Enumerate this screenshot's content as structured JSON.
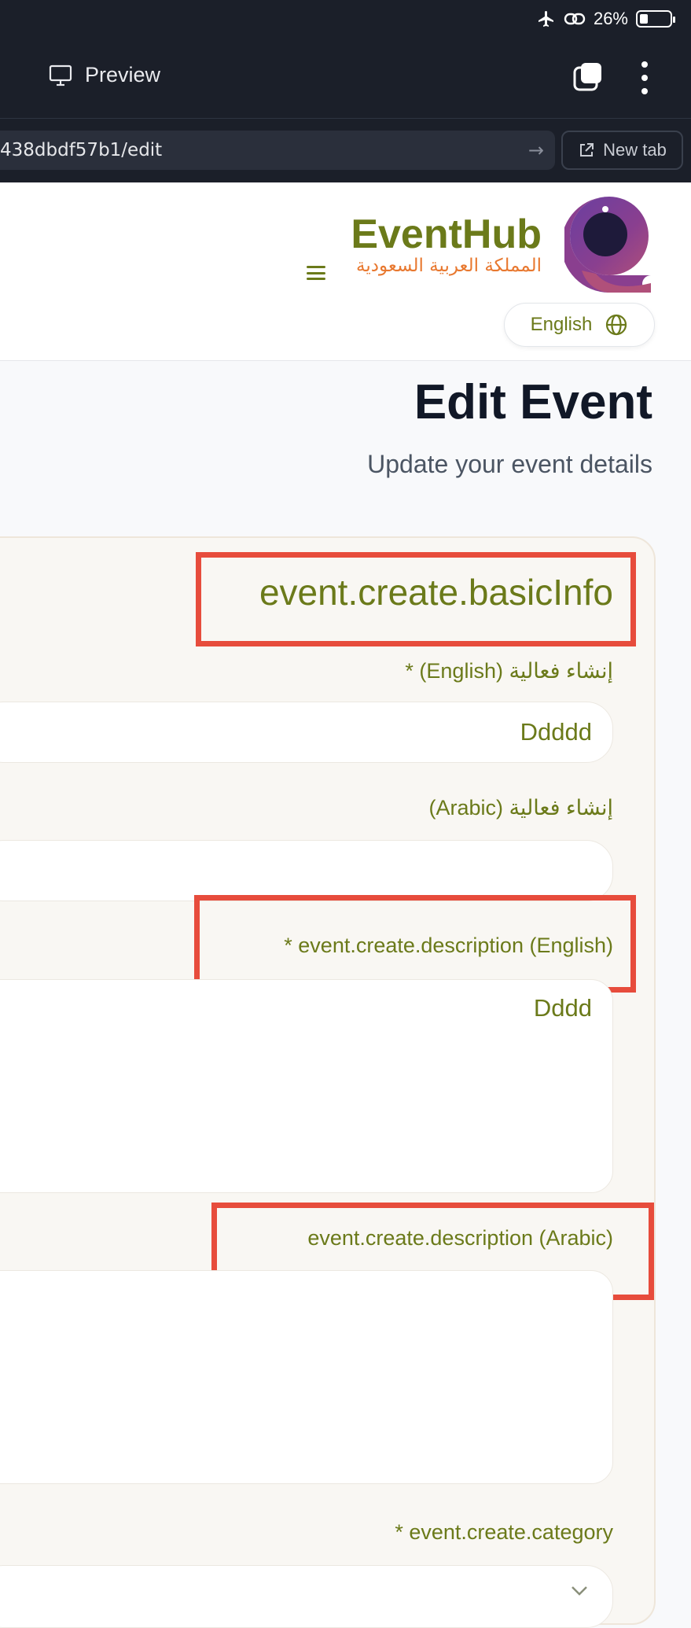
{
  "status_bar": {
    "battery": "26%"
  },
  "browser": {
    "preview_label": "Preview",
    "url": "438dbdf57b1/edit",
    "new_tab_label": "New tab"
  },
  "header": {
    "brand": "EventHub",
    "brand_subtitle": "المملكة العربية السعودية",
    "language_button": "English"
  },
  "page": {
    "title": "Edit Event",
    "subtitle": "Update your event details"
  },
  "form": {
    "section_title": "event.create.basicInfo",
    "title_en_label": "إنشاء فعالية (English) *",
    "title_en_value": "Ddddd",
    "title_ar_label": "إنشاء فعالية (Arabic)",
    "title_ar_value": "",
    "desc_en_label": "* event.create.description (English)",
    "desc_en_value": "Dddd",
    "desc_ar_label": "event.create.description (Arabic)",
    "desc_ar_value": "",
    "category_label": "* event.create.category"
  },
  "colors": {
    "brand": "#6b7a1a",
    "accent": "#e8782f",
    "highlight": "#e74c3c"
  }
}
